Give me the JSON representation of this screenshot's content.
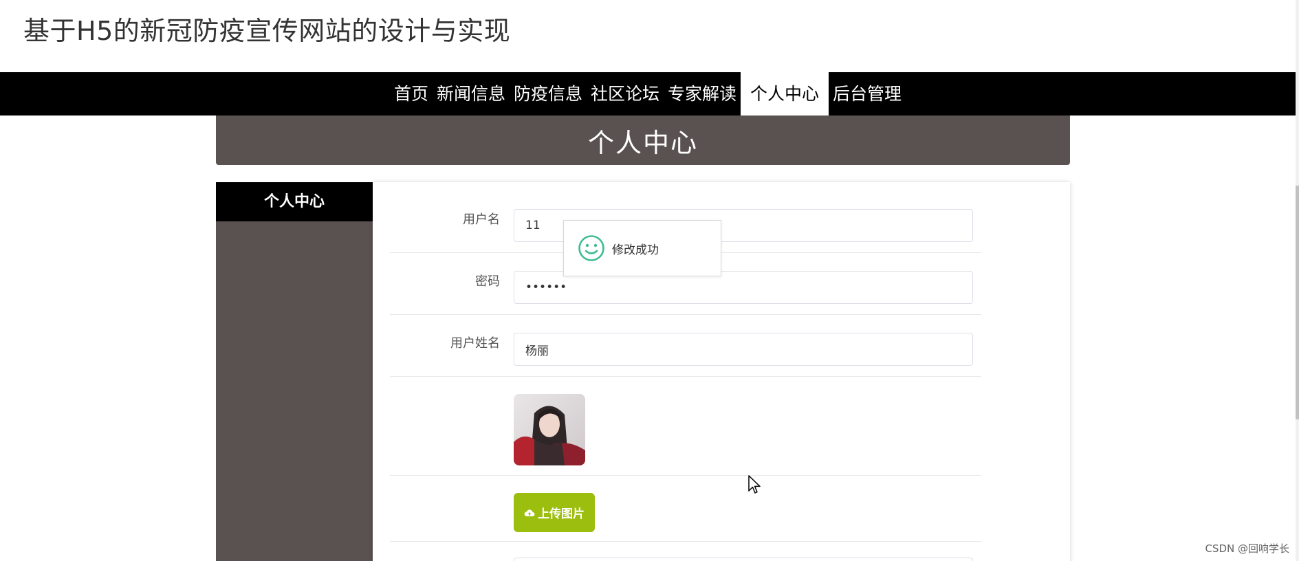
{
  "site": {
    "title": "基于H5的新冠防疫宣传网站的设计与实现"
  },
  "nav": {
    "items": [
      {
        "label": "首页"
      },
      {
        "label": "新闻信息"
      },
      {
        "label": "防疫信息"
      },
      {
        "label": "社区论坛"
      },
      {
        "label": "专家解读"
      },
      {
        "label": "个人中心",
        "active": true
      },
      {
        "label": "后台管理"
      }
    ]
  },
  "banner": {
    "title": "个人中心"
  },
  "sidebar": {
    "heading": "个人中心"
  },
  "form": {
    "username": {
      "label": "用户名",
      "value": "11"
    },
    "password": {
      "label": "密码",
      "value": "••••••"
    },
    "realname": {
      "label": "用户姓名",
      "value": "杨丽"
    },
    "upload_label": "上传图片"
  },
  "toast": {
    "message": "修改成功",
    "icon": "smile-icon"
  },
  "watermark": "CSDN @回响学长",
  "colors": {
    "nav_bg": "#000000",
    "banner_bg": "#5a5250",
    "upload_btn": "#9cbe0f",
    "toast_icon": "#3dbd8f"
  }
}
